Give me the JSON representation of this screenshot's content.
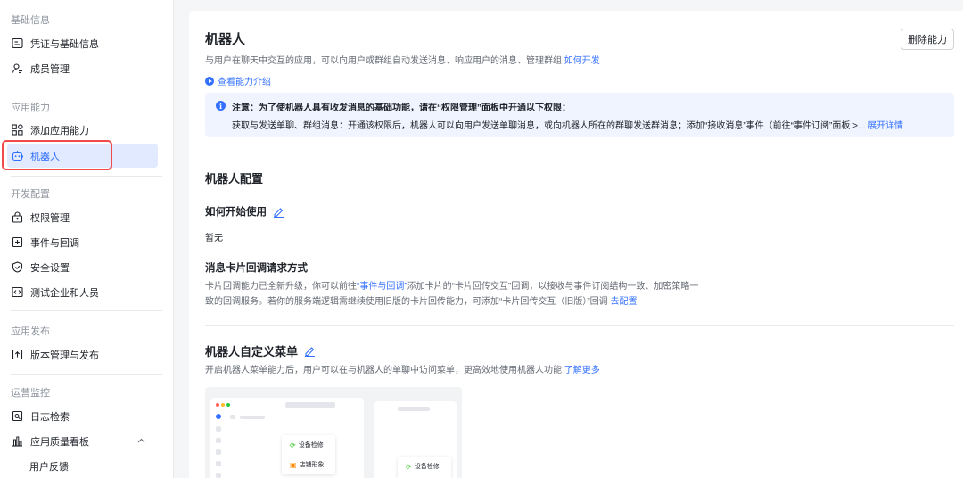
{
  "sidebar": {
    "sections": [
      {
        "title": "基础信息",
        "items": [
          {
            "label": "凭证与基础信息",
            "icon": "id-card-icon"
          },
          {
            "label": "成员管理",
            "icon": "member-icon"
          }
        ]
      },
      {
        "title": "应用能力",
        "items": [
          {
            "label": "添加应用能力",
            "icon": "grid-plus-icon"
          },
          {
            "label": "机器人",
            "icon": "bot-icon",
            "active": true
          }
        ]
      },
      {
        "title": "开发配置",
        "items": [
          {
            "label": "权限管理",
            "icon": "lock-icon"
          },
          {
            "label": "事件与回调",
            "icon": "event-icon"
          },
          {
            "label": "安全设置",
            "icon": "shield-icon"
          },
          {
            "label": "测试企业和人员",
            "icon": "code-icon"
          }
        ]
      },
      {
        "title": "应用发布",
        "items": [
          {
            "label": "版本管理与发布",
            "icon": "upload-icon"
          }
        ]
      },
      {
        "title": "运营监控",
        "items": [
          {
            "label": "日志检索",
            "icon": "log-search-icon"
          },
          {
            "label": "应用质量看板",
            "icon": "chart-icon",
            "expanded": true
          },
          {
            "label": "用户反馈"
          }
        ]
      }
    ]
  },
  "page": {
    "title": "机器人",
    "delete_button": "删除能力",
    "description": "与用户在聊天中交互的应用，可以向用户或群组自动发送消息、响应用户的消息、管理群组",
    "description_link": "如何开发",
    "view_intro": "查看能力介绍",
    "notice_title": "注意：为了使机器人具有收发消息的基础功能，请在“权限管理”面板中开通以下权限：",
    "notice_body": "获取与发送单聊、群组消息：开通该权限后，机器人可以向用户发送单聊消息，或向机器人所在的群聊发送群消息；添加“接收消息”事件（前往“事件订阅”面板 >...",
    "notice_link": "展开详情"
  },
  "config": {
    "heading": "机器人配置",
    "howto_heading": "如何开始使用",
    "howto_value": "暂无",
    "card_heading": "消息卡片回调请求方式",
    "card_para1_a": "卡片回调能力已全新升级，你可以前往",
    "card_para1_link": "“事件与回调”",
    "card_para1_b": "添加卡片的“卡片回传交互”回调，以接收与事件订阅结构一致、加密策略一",
    "card_para2": "致的回调服务。若你的服务端逻辑需继续使用旧版的卡片回传能力，可添加“卡片回传交互（旧版）”回调",
    "card_para2_link": "去配置"
  },
  "menu_section": {
    "heading": "机器人自定义菜单",
    "description": "开启机器人菜单能力后，用户可以在与机器人的单聊中访问菜单，更高效地使用机器人功能",
    "description_link": "了解更多",
    "preview_items": [
      "设备检修",
      "店铺形象"
    ]
  },
  "colors": {
    "accent": "#3370ff",
    "active_bg": "#e1eaff",
    "highlight_border": "#f04a4a",
    "notice_bg": "#f0f4ff"
  }
}
